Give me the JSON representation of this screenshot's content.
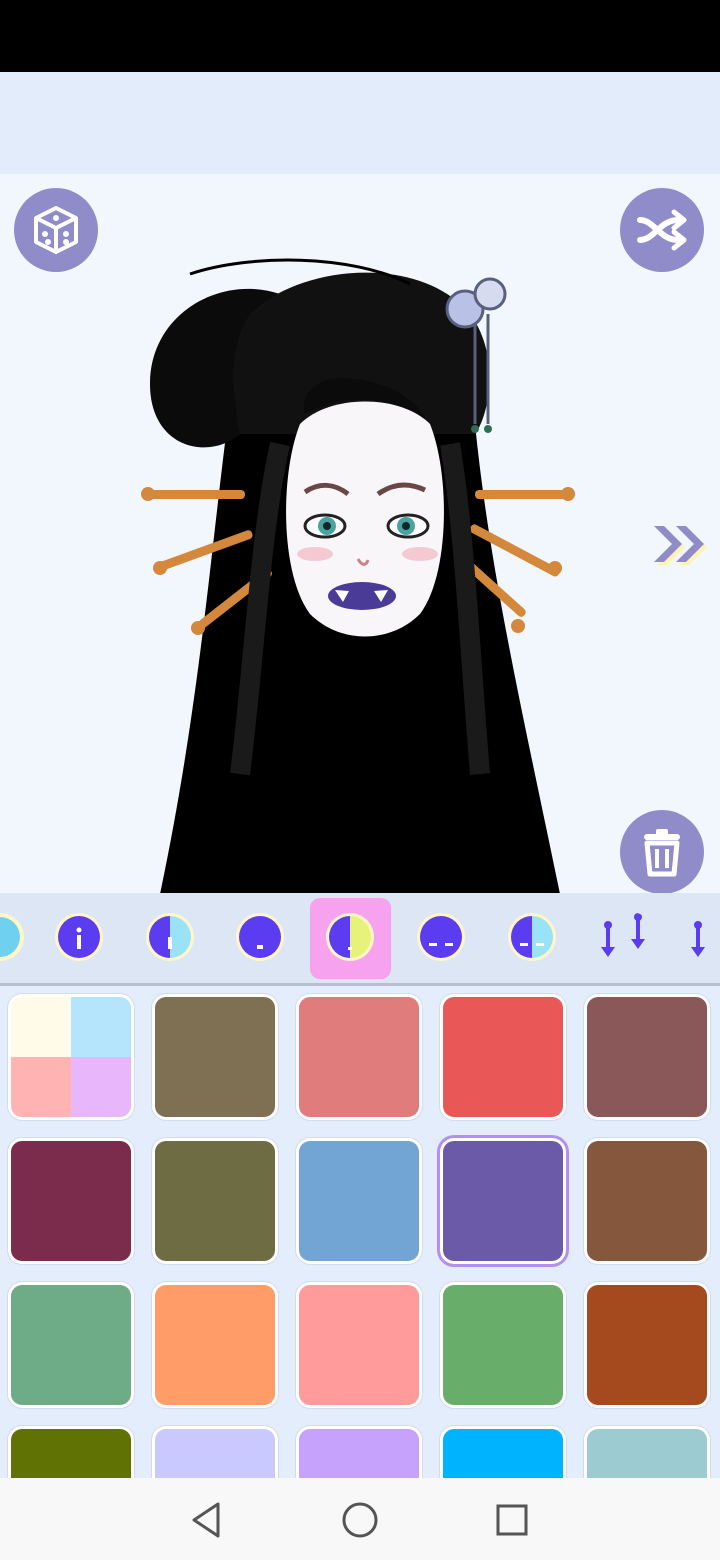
{
  "app": {
    "accent_color": "#8f8cc9",
    "selected_tool_color": "#f6a2ee",
    "tool_icon_color": "#5b3cf0"
  },
  "canvas": {
    "buttons": [
      {
        "name": "randomize",
        "icon": "dice-icon"
      },
      {
        "name": "shuffle",
        "icon": "shuffle-icon"
      },
      {
        "name": "next",
        "icon": "double-chevron-right-icon"
      },
      {
        "name": "delete",
        "icon": "trash-icon"
      }
    ],
    "character": {
      "description_icon": "character-avatar"
    }
  },
  "toolbar": {
    "selected_index": 4,
    "tools": [
      {
        "icon": "color-variant-partial-icon"
      },
      {
        "icon": "color-variant-1-icon"
      },
      {
        "icon": "color-variant-2-icon"
      },
      {
        "icon": "color-variant-3-icon"
      },
      {
        "icon": "color-variant-split-icon"
      },
      {
        "icon": "color-variant-5-icon"
      },
      {
        "icon": "color-variant-6-icon"
      },
      {
        "icon": "piercing-pair-icon"
      },
      {
        "icon": "piercing-single-icon"
      }
    ]
  },
  "swatches": {
    "selected_index": 8,
    "colors": [
      [
        "#fffbe8",
        "#b5e4fd",
        "#ffb3b3",
        "#e8b6fb"
      ],
      "#7f6f53",
      "#e07c7c",
      "#e95757",
      "#8a5858",
      "#7b2b4b",
      "#6d6c43",
      "#73a5d4",
      "#6a5aa8",
      "#85573c",
      "#6eab87",
      "#ff9c68",
      "#ff9b9b",
      "#68ad6a",
      "#a54a1f",
      "#607203",
      "#c9c9ff",
      "#c7a2fc",
      "#00b3ff",
      "#9ccbd1"
    ]
  },
  "nav": {
    "items": [
      {
        "icon": "back-triangle-icon"
      },
      {
        "icon": "home-circle-icon"
      },
      {
        "icon": "recents-square-icon"
      }
    ]
  }
}
